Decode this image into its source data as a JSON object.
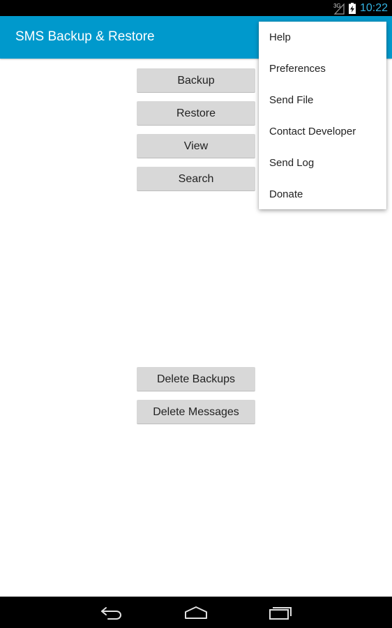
{
  "status_bar": {
    "network": "3G",
    "time": "10:22",
    "icons": [
      "signal-icon",
      "battery-charging-icon"
    ],
    "clock_color": "#33b5e5"
  },
  "action_bar": {
    "title": "SMS Backup & Restore",
    "color": "#0099cc"
  },
  "buttons": {
    "backup": "Backup",
    "restore": "Restore",
    "view": "View",
    "search": "Search",
    "delete_backups": "Delete Backups",
    "delete_messages": "Delete Messages"
  },
  "overflow_menu": {
    "items": [
      {
        "label": "Help"
      },
      {
        "label": "Preferences"
      },
      {
        "label": "Send File"
      },
      {
        "label": "Contact Developer"
      },
      {
        "label": "Send Log"
      },
      {
        "label": "Donate"
      }
    ]
  },
  "nav_bar": {
    "icons": [
      "back-icon",
      "home-icon",
      "recent-apps-icon"
    ]
  }
}
